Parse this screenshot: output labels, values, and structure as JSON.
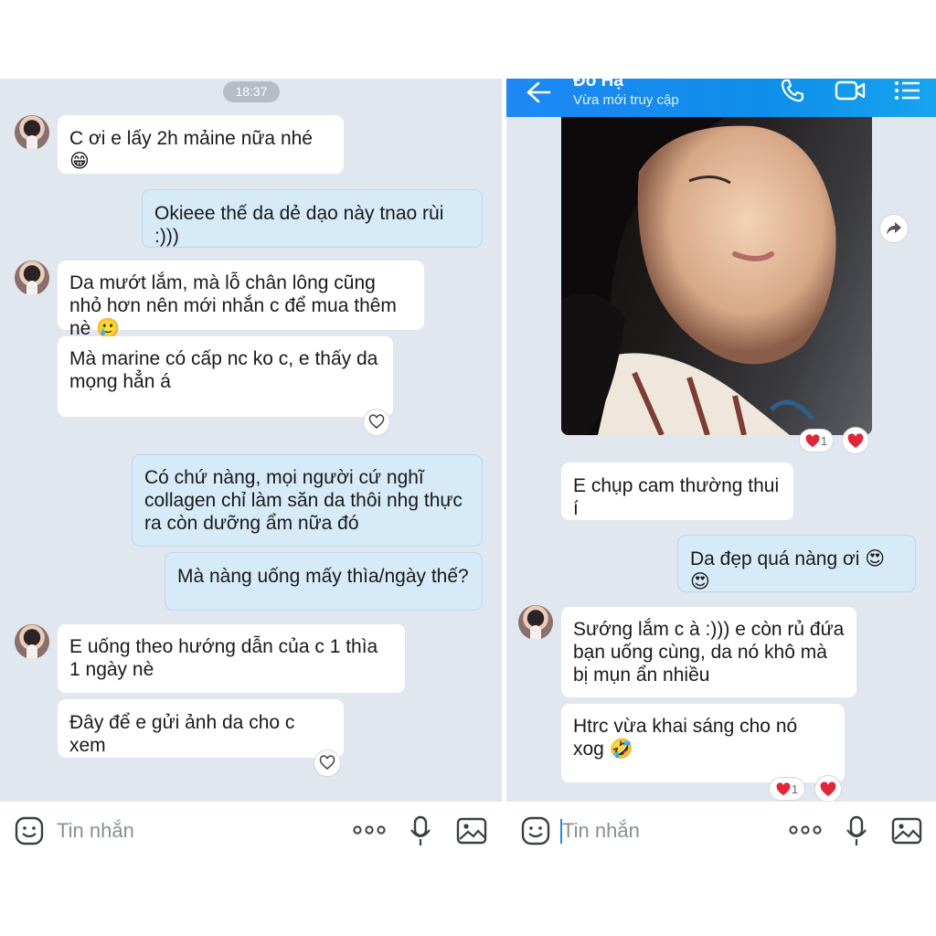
{
  "left": {
    "time": "18:37",
    "messages": [
      "C ơi e lấy 2h mảine nữa nhé 😁",
      "Okieee thế da dẻ dạo này tnao rùi :)))",
      "Da mướt lắm, mà lỗ chân lông cũng nhỏ hơn nên mới nhắn c để mua thêm nè 🥲",
      "Mà marine có cấp nc ko c, e thấy da mọng hẳn á",
      "Có chứ nàng, mọi người cứ nghĩ collagen chỉ làm săn da thôi nhg thực ra còn dưỡng ẩm nữa đó",
      "Mà nàng uống mấy thìa/ngày thế?",
      "E uống theo hướng dẫn của c 1 thìa 1 ngày nè",
      "Đây để e gửi ảnh da cho c xem"
    ],
    "input_placeholder": "Tin nhắn"
  },
  "right": {
    "contact_name": "Đỗ Hạ",
    "contact_status": "Vừa mới truy cập",
    "photo_reaction_count": "1",
    "messages": [
      "E chụp cam thường thui í",
      "Da đẹp quá nàng ơi 😍😍",
      "Sướng lắm c à :))) e còn rủ đứa bạn uống cùng, da nó khô mà bị mụn ẩn nhiều",
      "Htrc vừa khai sáng cho nó xog 🤣"
    ],
    "last_reaction_count": "1",
    "input_placeholder": "Tin nhắn"
  },
  "colors": {
    "outgoing_bubble": "#d6eaf8",
    "incoming_bubble": "#ffffff",
    "chat_background": "#e1e7ef",
    "header_blue": "#1e88f5",
    "heart_red": "#e02638"
  },
  "icons": [
    "emoji-icon",
    "more-icon",
    "mic-icon",
    "image-icon",
    "back-arrow-icon",
    "phone-icon",
    "video-icon",
    "menu-icon",
    "heart-icon",
    "share-icon"
  ]
}
